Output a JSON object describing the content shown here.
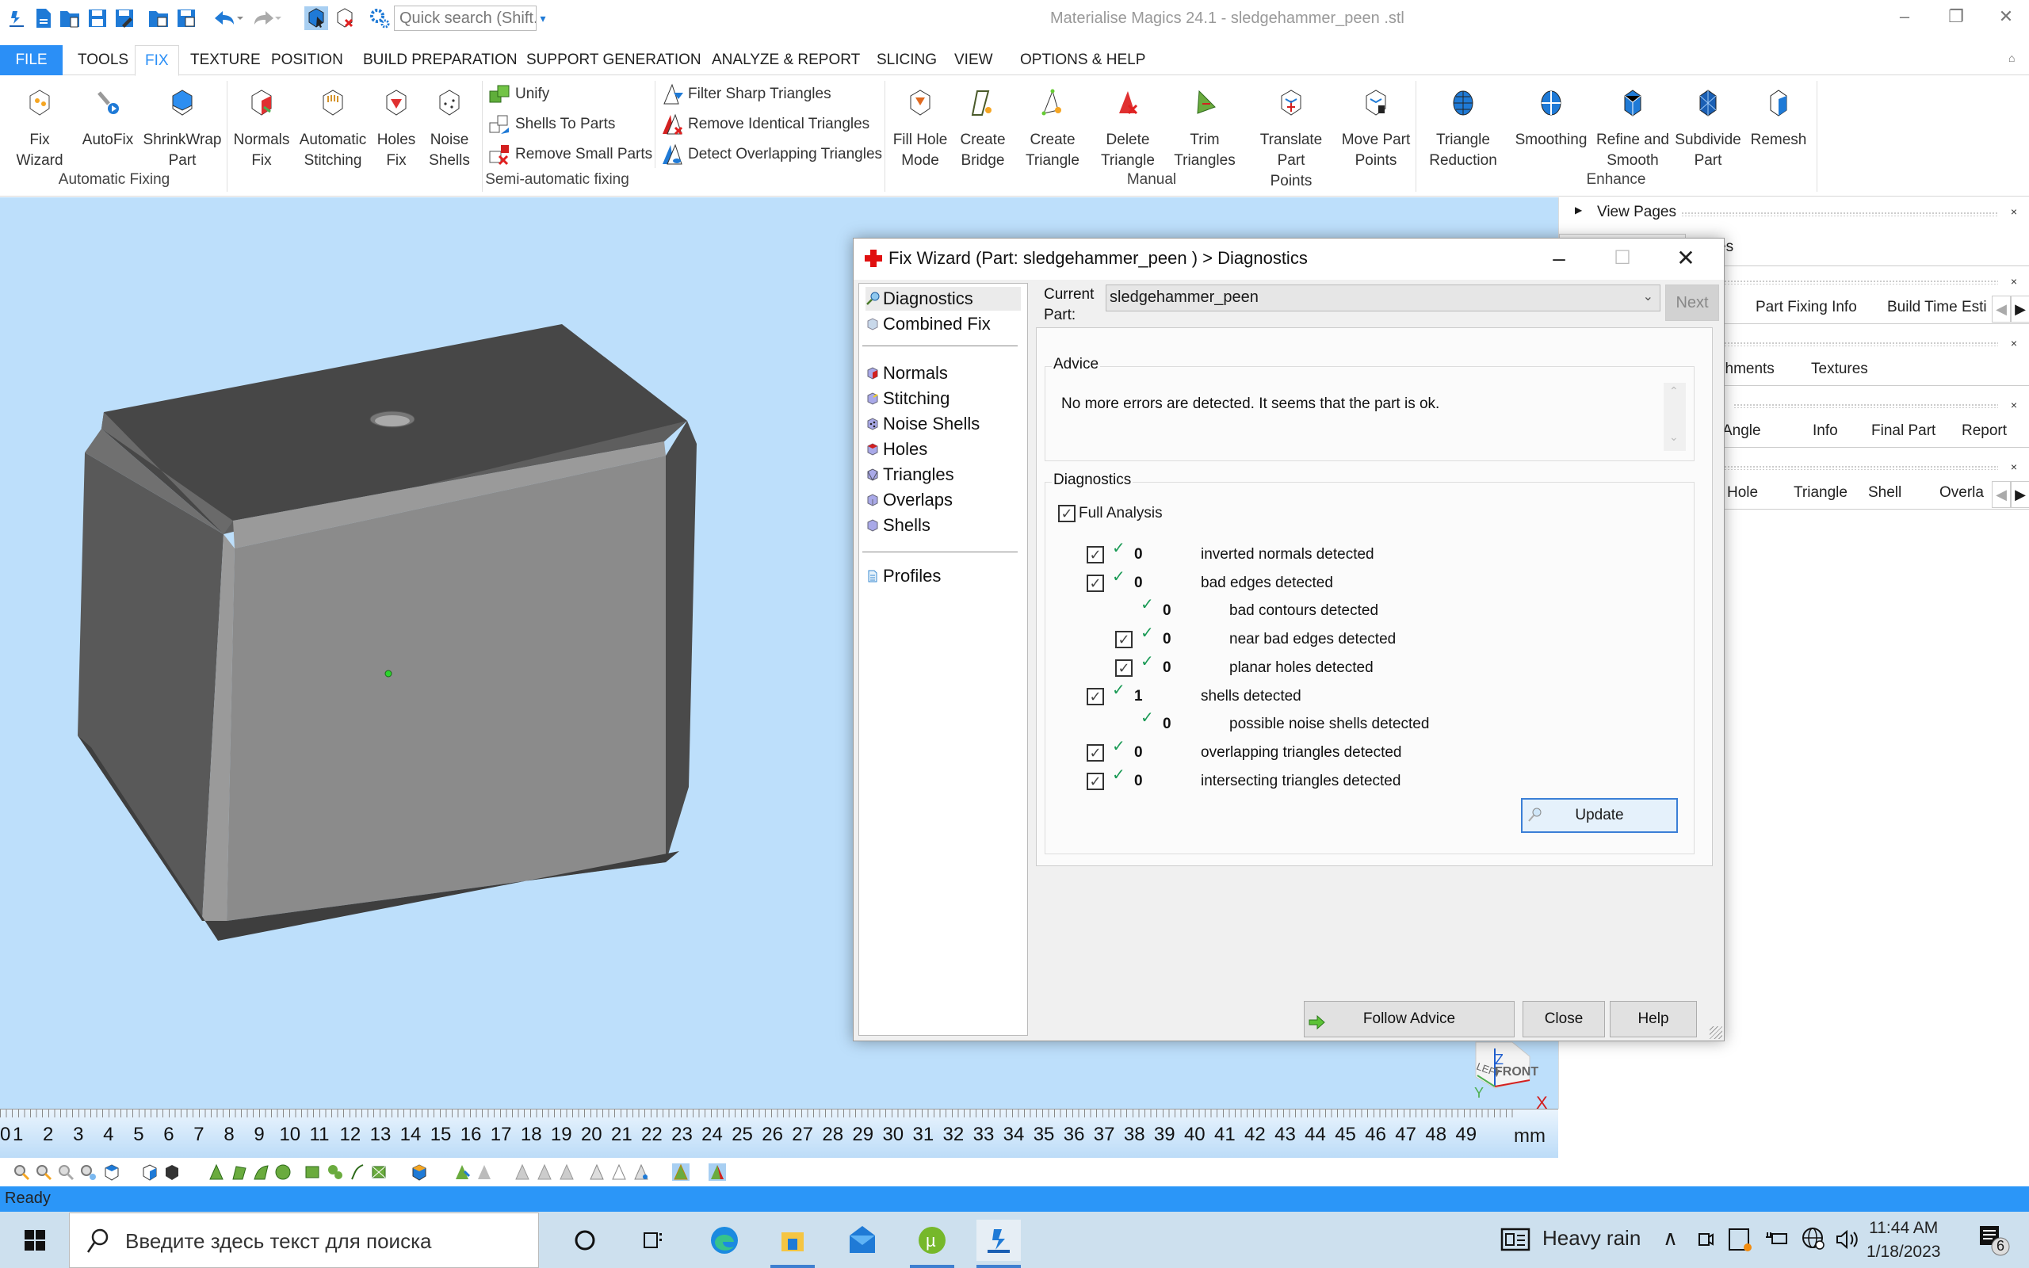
{
  "app": {
    "title": "Materialise Magics 24.1 - sledgehammer_peen .stl",
    "quick_search_placeholder": "Quick search (Shift..."
  },
  "window_controls": {
    "minimize": "‒",
    "restore": "❐",
    "close": "✕"
  },
  "menu_tabs": [
    {
      "label": "FILE",
      "state": "file"
    },
    {
      "label": "TOOLS"
    },
    {
      "label": "FIX",
      "state": "active"
    },
    {
      "label": "TEXTURE"
    },
    {
      "label": "POSITION"
    },
    {
      "label": "BUILD PREPARATION"
    },
    {
      "label": "SUPPORT GENERATION"
    },
    {
      "label": "ANALYZE & REPORT"
    },
    {
      "label": "SLICING"
    },
    {
      "label": "VIEW"
    },
    {
      "label": "OPTIONS & HELP"
    }
  ],
  "ribbon": {
    "groups": {
      "automatic": "Automatic Fixing",
      "semi": "Semi-automatic fixing",
      "manual": "Manual",
      "enhance": "Enhance"
    },
    "automatic_items": [
      {
        "l1": "Fix Wizard",
        "l2": ""
      },
      {
        "l1": "AutoFix",
        "l2": ""
      },
      {
        "l1": "ShrinkWrap",
        "l2": "Part"
      }
    ],
    "fix_items": [
      {
        "l1": "Normals",
        "l2": "Fix"
      },
      {
        "l1": "Automatic",
        "l2": "Stitching"
      },
      {
        "l1": "Holes",
        "l2": "Fix"
      },
      {
        "l1": "Noise",
        "l2": "Shells"
      }
    ],
    "semi_col1": [
      "Unify",
      "Shells To Parts",
      "Remove Small Parts"
    ],
    "semi_col2": [
      "Filter Sharp Triangles",
      "Remove Identical Triangles",
      "Detect Overlapping Triangles"
    ],
    "manual_items": [
      {
        "l1": "Fill Hole",
        "l2": "Mode"
      },
      {
        "l1": "Create",
        "l2": "Bridge"
      },
      {
        "l1": "Create",
        "l2": "Triangle"
      },
      {
        "l1": "Delete",
        "l2": "Triangle"
      },
      {
        "l1": "Trim",
        "l2": "Triangles"
      },
      {
        "l1": "Translate Part",
        "l2": "Points"
      },
      {
        "l1": "Move Part",
        "l2": "Points"
      }
    ],
    "enhance_items": [
      {
        "l1": "Triangle",
        "l2": "Reduction"
      },
      {
        "l1": "Smoothing",
        "l2": ""
      },
      {
        "l1": "Refine and",
        "l2": "Smooth"
      },
      {
        "l1": "Subdivide",
        "l2": "Part"
      },
      {
        "l1": "Remesh",
        "l2": ""
      }
    ]
  },
  "right_panel": {
    "view_pages": "View Pages",
    "partial_es": "es",
    "tabs_row1": [
      "Part Fixing Info",
      "Build Time Esti"
    ],
    "tabs_row2": [
      "chments",
      "Textures"
    ],
    "partial_s": "s",
    "tabs_row3": [
      "Angle",
      "Info",
      "Final Part",
      "Report"
    ],
    "tabs_row4": [
      "Hole",
      "Triangle",
      "Shell",
      "Overla"
    ]
  },
  "dialog": {
    "title": "Fix Wizard (Part: sledgehammer_peen ) > Diagnostics",
    "nav_top": [
      "Diagnostics",
      "Combined Fix"
    ],
    "nav_mid": [
      "Normals",
      "Stitching",
      "Noise Shells",
      "Holes",
      "Triangles",
      "Overlaps",
      "Shells"
    ],
    "nav_bottom": [
      "Profiles"
    ],
    "current_part_label": "Current Part:",
    "current_part_value": "sledgehammer_peen",
    "next_label": "Next",
    "advice_title": "Advice",
    "advice_text": "No more errors are detected. It seems that the part is ok.",
    "diagnostics_title": "Diagnostics",
    "full_analysis_label": "Full Analysis",
    "full_analysis_checked": true,
    "rows": [
      {
        "count": "0",
        "label": "inverted normals detected",
        "checkbox": true,
        "indent": 0,
        "ok": true
      },
      {
        "count": "0",
        "label": "bad edges detected",
        "checkbox": true,
        "indent": 0,
        "ok": true
      },
      {
        "count": "0",
        "label": "bad contours detected",
        "checkbox": false,
        "indent": 1,
        "ok": true
      },
      {
        "count": "0",
        "label": "near bad edges detected",
        "checkbox": true,
        "indent": 1,
        "ok": true
      },
      {
        "count": "0",
        "label": "planar holes detected",
        "checkbox": true,
        "indent": 1,
        "ok": true
      },
      {
        "count": "1",
        "label": "shells detected",
        "checkbox": true,
        "indent": 0,
        "ok": true
      },
      {
        "count": "0",
        "label": "possible noise shells detected",
        "checkbox": false,
        "indent": 1,
        "ok": true
      },
      {
        "count": "0",
        "label": "overlapping triangles detected",
        "checkbox": true,
        "indent": 0,
        "ok": true
      },
      {
        "count": "0",
        "label": "intersecting triangles detected",
        "checkbox": true,
        "indent": 0,
        "ok": true
      }
    ],
    "update_label": "Update",
    "follow_advice_label": "Follow Advice",
    "close_label": "Close",
    "help_label": "Help"
  },
  "view_cube": {
    "left": "LEFT",
    "front": "FRONT",
    "z": "Z",
    "y": "Y",
    "x": "X"
  },
  "ruler": {
    "numbers": [
      "0",
      "1",
      "2",
      "3",
      "4",
      "5",
      "6",
      "7",
      "8",
      "9",
      "10",
      "11",
      "12",
      "13",
      "14",
      "15",
      "16",
      "17",
      "18",
      "19",
      "20",
      "21",
      "22",
      "23",
      "24",
      "25",
      "26",
      "27",
      "28",
      "29",
      "30",
      "31",
      "32",
      "33",
      "34",
      "35",
      "36",
      "37",
      "38",
      "39",
      "40",
      "41",
      "42",
      "43",
      "44",
      "45",
      "46",
      "47",
      "48",
      "49"
    ],
    "unit": "mm"
  },
  "status": {
    "text": "Ready"
  },
  "taskbar": {
    "search_placeholder": "Введите здесь текст для поиска",
    "weather": "Heavy rain",
    "time": "11:44 AM",
    "date": "1/18/2023",
    "notifications": "6"
  },
  "colors": {
    "accent": "#2b8ff6",
    "viewport_bg": "#bddffb",
    "status_bar": "#2b96f8",
    "ok_check": "#1a9a55"
  }
}
